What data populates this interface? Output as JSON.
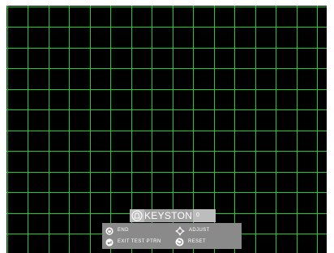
{
  "pattern": {
    "type": "test-grid",
    "line_color": "#1fcf1f",
    "background_color": "#000000"
  },
  "keystone": {
    "icon": "keystone-icon",
    "title": "KEYSTONE",
    "value": "0"
  },
  "help": {
    "end": {
      "icon": "power-icon",
      "label": "END"
    },
    "exit": {
      "icon": "enter-icon",
      "label": "EXIT TEST PTRN"
    },
    "adjust": {
      "icon": "four-way-arrows-icon",
      "label": "ADJUST"
    },
    "reset": {
      "icon": "reset-icon",
      "label": "RESET"
    }
  }
}
